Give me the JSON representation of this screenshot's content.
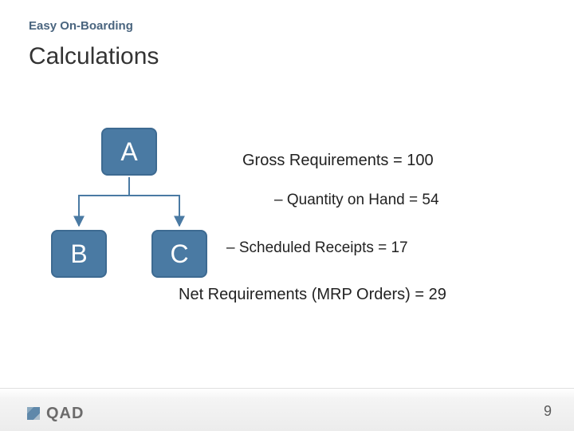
{
  "header": {
    "eyebrow": "Easy On-Boarding",
    "title": "Calculations"
  },
  "diagram": {
    "nodes": {
      "a": "A",
      "b": "B",
      "c": "C"
    }
  },
  "equations": {
    "line1": "Gross Requirements = 100",
    "line2": "– Quantity on Hand = 54",
    "line3": "– Scheduled Receipts = 17",
    "line4": "Net Requirements (MRP Orders) = 29"
  },
  "footer": {
    "brand": "QAD",
    "page_number": "9"
  }
}
